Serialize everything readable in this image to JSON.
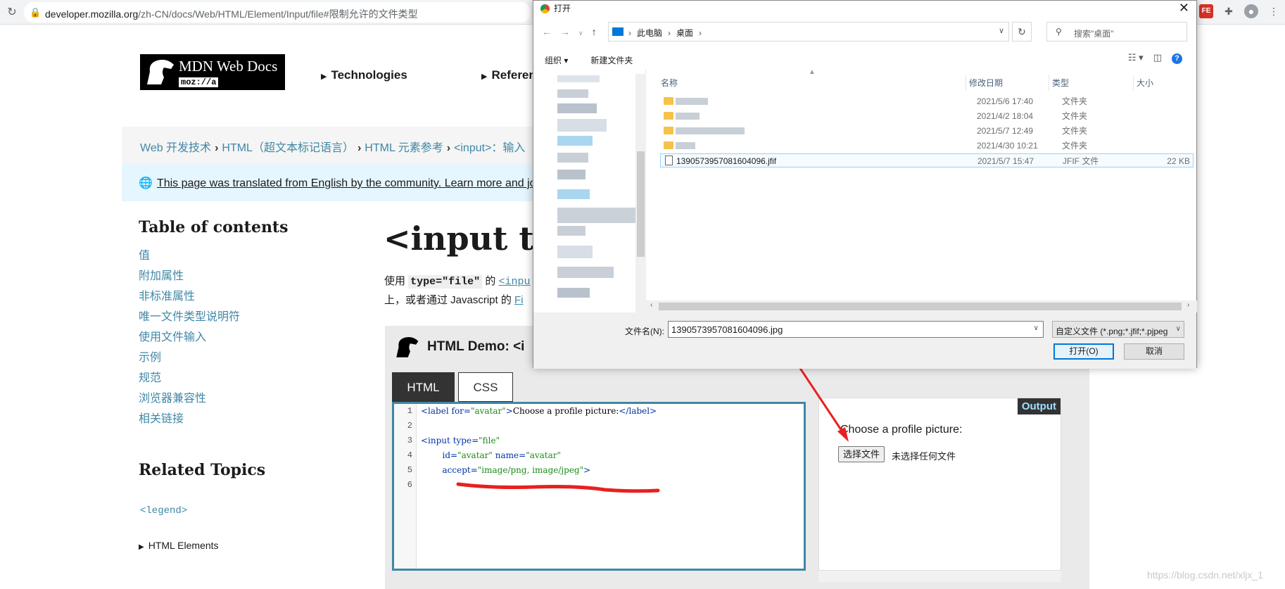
{
  "browser": {
    "url_domain": "developer.mozilla.org",
    "url_path": "/zh-CN/docs/Web/HTML/Element/Input/file#限制允许的文件类型"
  },
  "mdn": {
    "logo_text": "MDN Web Docs",
    "logo_sub": "moz://a",
    "nav": [
      "Technologies",
      "Referen"
    ]
  },
  "breadcrumbs": [
    "Web 开发技术",
    "HTML（超文本标记语言）",
    "HTML 元素参考",
    "<input>：输入"
  ],
  "notice": {
    "link_text": "This page was translated from English by the community. Learn more and jo"
  },
  "toc": {
    "title": "Table of contents",
    "items": [
      "值",
      "附加属性",
      "非标准属性",
      "唯一文件类型说明符",
      "使用文件输入",
      "示例",
      "规范",
      "浏览器兼容性",
      "相关链接"
    ]
  },
  "related": {
    "title": "Related Topics",
    "legend": "<legend>",
    "html_elements": "HTML Elements"
  },
  "article": {
    "h1": "<input typ",
    "p1_pre": "使用 ",
    "p1_code": "type=\"file\"",
    "p1_mid": " 的 ",
    "p1_link": "<inpu",
    "p2_pre": "上，或者通过 Javascript 的 ",
    "p2_link": "Fi"
  },
  "demo": {
    "title": "HTML Demo: <i",
    "tab_html": "HTML",
    "tab_css": "CSS",
    "line_numbers": [
      "1",
      "2",
      "3",
      "4",
      "5",
      "6"
    ],
    "output_badge": "Output",
    "output_label": "Choose a profile picture:",
    "choose_button": "选择文件",
    "no_file": "未选择任何文件"
  },
  "dialog": {
    "title": "打开",
    "close": "✕",
    "path": [
      "此电脑",
      "桌面"
    ],
    "search_placeholder": "搜索\"桌面\"",
    "organize": "组织 ▾",
    "new_folder": "新建文件夹",
    "columns": {
      "name": "名称",
      "date": "修改日期",
      "type": "类型",
      "size": "大小"
    },
    "rows": [
      {
        "date": "2021/5/6 17:40",
        "type": "文件夹"
      },
      {
        "date": "2021/4/2 18:04",
        "type": "文件夹"
      },
      {
        "date": "2021/5/7 12:49",
        "type": "文件夹"
      },
      {
        "date": "2021/4/30 10:21",
        "type": "文件夹"
      },
      {
        "name": "1390573957081604096.jfif",
        "date": "2021/5/7 15:47",
        "type": "JFIF 文件",
        "size": "22 KB"
      }
    ],
    "filename_label": "文件名(N):",
    "filename_value": "1390573957081604096.jpg",
    "filetype_value": "自定义文件 (*.png;*.jfif;*.pjpeg",
    "open_button": "打开(O)",
    "cancel_button": "取消"
  },
  "watermark": "https://blog.csdn.net/xljx_1"
}
